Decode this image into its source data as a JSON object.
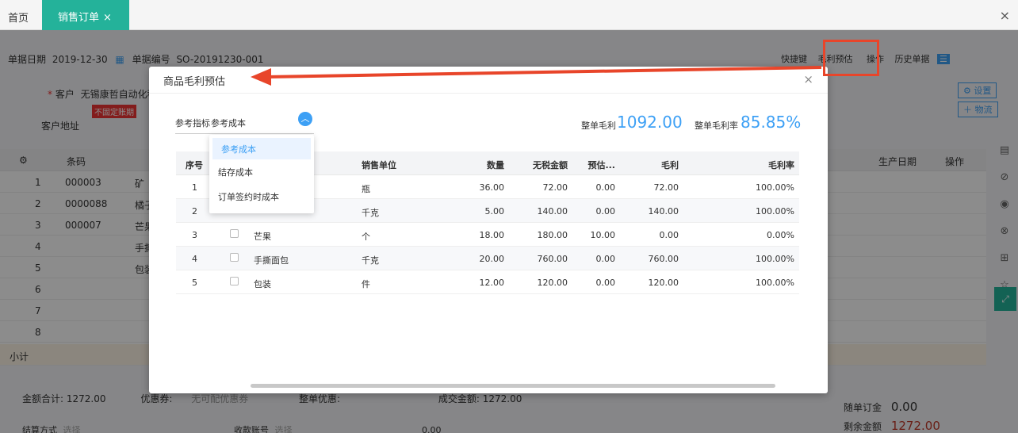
{
  "tabs": {
    "home": "首页",
    "active": "销售订单",
    "active_close": "×",
    "app_close": "×"
  },
  "header": {
    "date_label": "单据日期",
    "date_value": "2019-12-30",
    "doc_no_label": "单据编号",
    "doc_no_value": "SO-20191230-001",
    "shortcut": "快捷键",
    "profit_estimate": "毛利预估",
    "operations": "操作",
    "history": "历史单据"
  },
  "customer": {
    "label": "客户",
    "value": "无锡康哲自动化科",
    "badge": "不固定账期",
    "address_label": "客户地址"
  },
  "right_actions": {
    "settings": "设置",
    "logistics": "物流"
  },
  "grid": {
    "headers": [
      "条码",
      "生产日期",
      "操作"
    ],
    "rows": [
      {
        "idx": "1",
        "code": "000003",
        "name": "矿"
      },
      {
        "idx": "2",
        "code": "0000088",
        "name": "橘子"
      },
      {
        "idx": "3",
        "code": "000007",
        "name": "芒果"
      },
      {
        "idx": "4",
        "code": "",
        "name": "手撕"
      },
      {
        "idx": "5",
        "code": "",
        "name": "包装"
      },
      {
        "idx": "6",
        "code": "",
        "name": ""
      },
      {
        "idx": "7",
        "code": "",
        "name": ""
      },
      {
        "idx": "8",
        "code": "",
        "name": ""
      }
    ],
    "subtotal": "小计"
  },
  "footer": {
    "total": "金额合计: 1272.00",
    "coupon_label": "优惠券:",
    "coupon_value": "无可配优惠券",
    "discount_label": "整单优惠:",
    "deal_amount": "成交金额: 1272.00",
    "settle_label": "结算方式",
    "settle_ph": "选择",
    "account_label": "收款账号",
    "account_ph": "选择",
    "amount_small": "0.00",
    "deposit_label": "随单订金",
    "deposit_value": "0.00",
    "remain_label": "剩余金额",
    "remain_value": "1272.00"
  },
  "modal": {
    "title": "商品毛利预估",
    "close": "×",
    "ref_label": "参考指标",
    "ref_value": "参考成本",
    "total_profit_label": "整单毛利",
    "total_profit_value": "1092.00",
    "total_rate_label": "整单毛利率",
    "total_rate_value": "85.85%",
    "dropdown": [
      "参考成本",
      "结存成本",
      "订单签约时成本"
    ],
    "columns": {
      "idx": "序号",
      "unit": "销售单位",
      "qty": "数量",
      "amount": "无税金额",
      "est": "预估...",
      "profit": "毛利",
      "rate": "毛利率"
    },
    "rows": [
      {
        "idx": "1",
        "name": "",
        "unit": "瓶",
        "qty": "36.00",
        "amount": "72.00",
        "est": "0.00",
        "profit": "72.00",
        "rate": "100.00%"
      },
      {
        "idx": "2",
        "name": "",
        "unit": "千克",
        "qty": "5.00",
        "amount": "140.00",
        "est": "0.00",
        "profit": "140.00",
        "rate": "100.00%"
      },
      {
        "idx": "3",
        "name": "芒果",
        "unit": "个",
        "qty": "18.00",
        "amount": "180.00",
        "est": "10.00",
        "profit": "0.00",
        "rate": "0.00%"
      },
      {
        "idx": "4",
        "name": "手撕面包",
        "unit": "千克",
        "qty": "20.00",
        "amount": "760.00",
        "est": "0.00",
        "profit": "760.00",
        "rate": "100.00%"
      },
      {
        "idx": "5",
        "name": "包装",
        "unit": "件",
        "qty": "12.00",
        "amount": "120.00",
        "est": "0.00",
        "profit": "120.00",
        "rate": "100.00%"
      }
    ]
  },
  "colors": {
    "accent": "#3da0f5",
    "tab": "#24b29a",
    "highlight": "#e8452a",
    "deposit": "#c0392b"
  }
}
